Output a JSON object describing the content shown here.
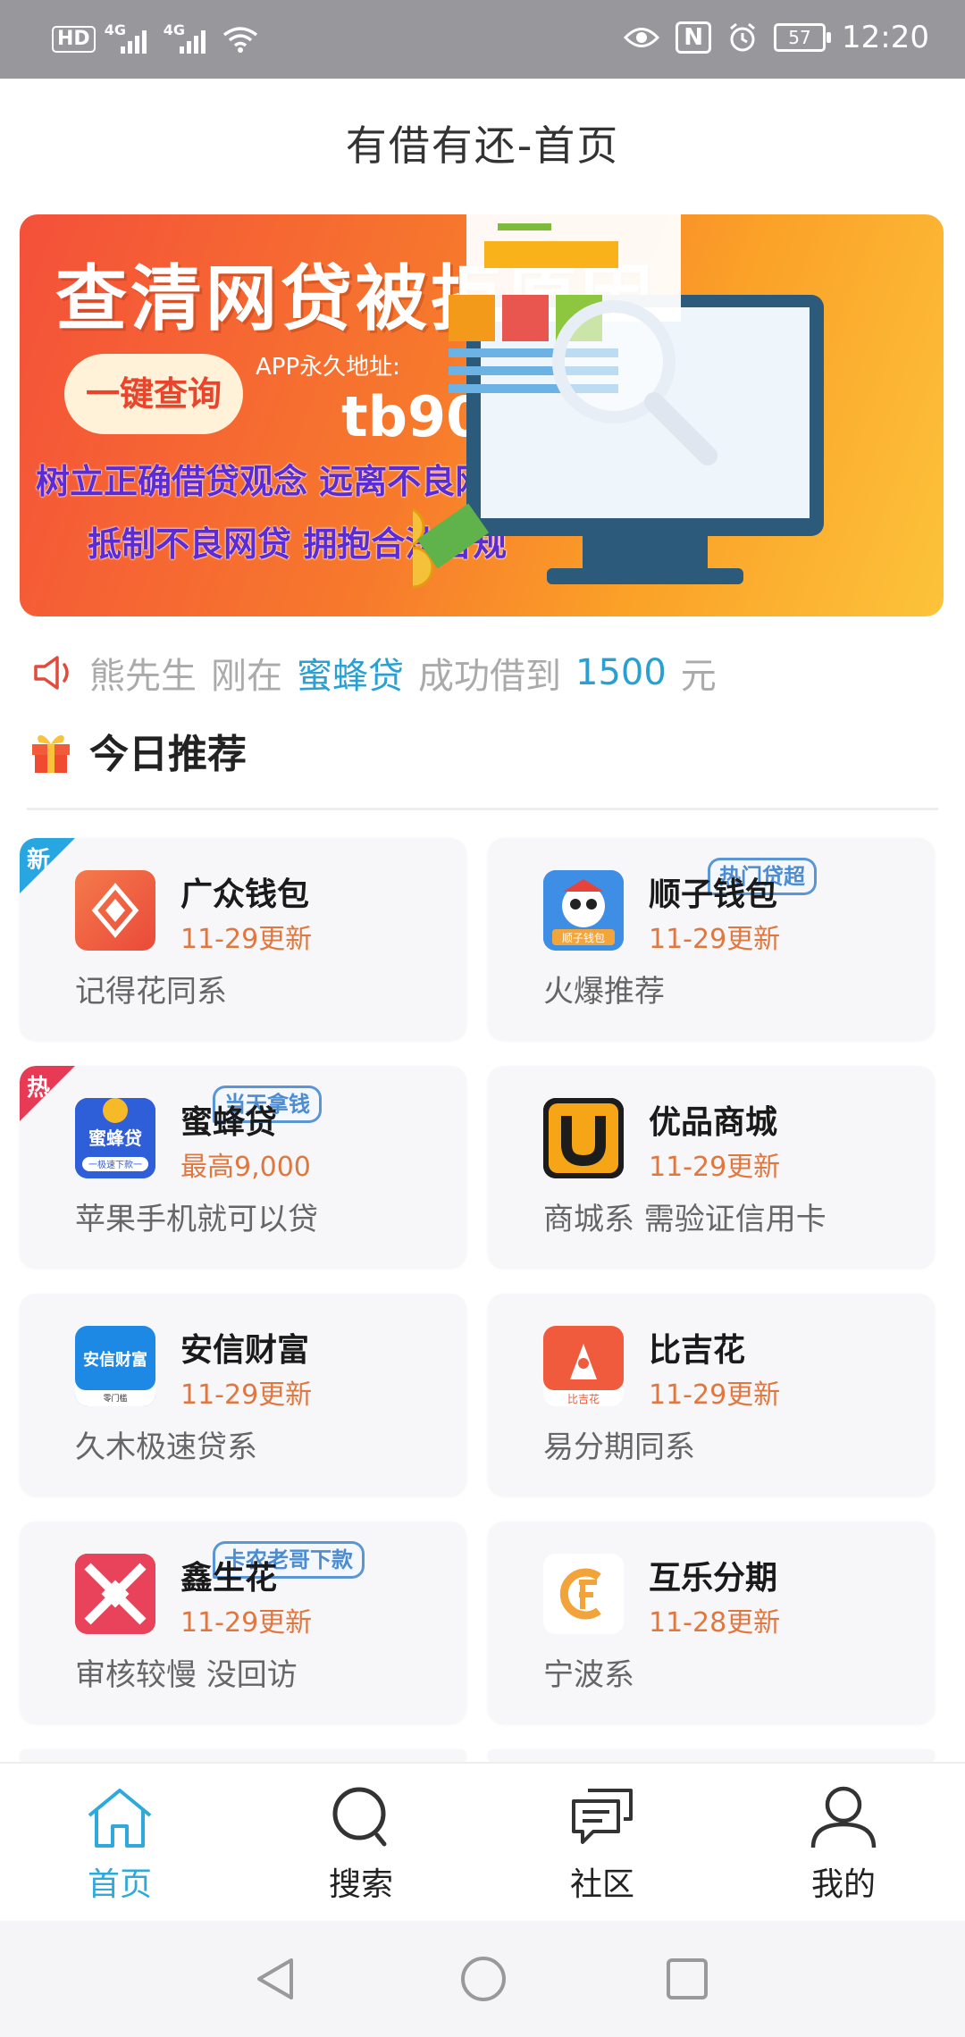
{
  "status_bar": {
    "hd": "HD",
    "sim1": "4G",
    "sim2": "4G",
    "nfc": "N",
    "battery": "57",
    "time": "12:20"
  },
  "header": {
    "title": "有借有还-首页"
  },
  "banner": {
    "headline": "查清网贷被拒原因",
    "button": "一键查询",
    "app_address_label": "APP永久地址:",
    "url": "tb901.cn",
    "slogan1": "树立正确借贷观念 远离不良网贷产品",
    "slogan2": "抵制不良网贷 拥抱合法合规"
  },
  "notice": {
    "name": "熊先生",
    "text1": "刚在",
    "platform": "蜜蜂贷",
    "text2": "成功借到",
    "amount": "1500",
    "unit": "元"
  },
  "section": {
    "title": "今日推荐"
  },
  "cards": [
    {
      "name": "广众钱包",
      "sub": "11-29更新",
      "desc": "记得花同系",
      "corner": "新"
    },
    {
      "name": "顺子钱包",
      "sub": "11-29更新",
      "desc": "火爆推荐",
      "tag": "热门贷超",
      "logo_text": "顺子钱包"
    },
    {
      "name": "蜜蜂贷",
      "sub": "最高9,000",
      "desc": "苹果手机就可以贷",
      "corner": "热",
      "tag": "当天拿钱",
      "logo_text": "蜜蜂贷",
      "logo_sub": "一极速下款一"
    },
    {
      "name": "优品商城",
      "sub": "11-29更新",
      "desc": "商城系 需验证信用卡"
    },
    {
      "name": "安信财富",
      "sub": "11-29更新",
      "desc": "久木极速贷系",
      "logo_text": "安信财富",
      "logo_sub": "零门槛"
    },
    {
      "name": "比吉花",
      "sub": "11-29更新",
      "desc": "易分期同系",
      "logo_text": "比吉花"
    },
    {
      "name": "鑫生花",
      "sub": "11-29更新",
      "desc": "审核较慢 没回访",
      "tag": "卡农老哥下款"
    },
    {
      "name": "互乐分期",
      "sub": "11-28更新",
      "desc": "宁波系"
    }
  ],
  "tabs": [
    {
      "label": "首页",
      "icon": "home-icon"
    },
    {
      "label": "搜索",
      "icon": "search-icon"
    },
    {
      "label": "社区",
      "icon": "chat-icon"
    },
    {
      "label": "我的",
      "icon": "user-icon"
    }
  ],
  "colors": {
    "accent": "#2fa9db",
    "orange_text": "#e0773f",
    "banner_start": "#f4503a",
    "banner_end": "#fcc33a"
  }
}
